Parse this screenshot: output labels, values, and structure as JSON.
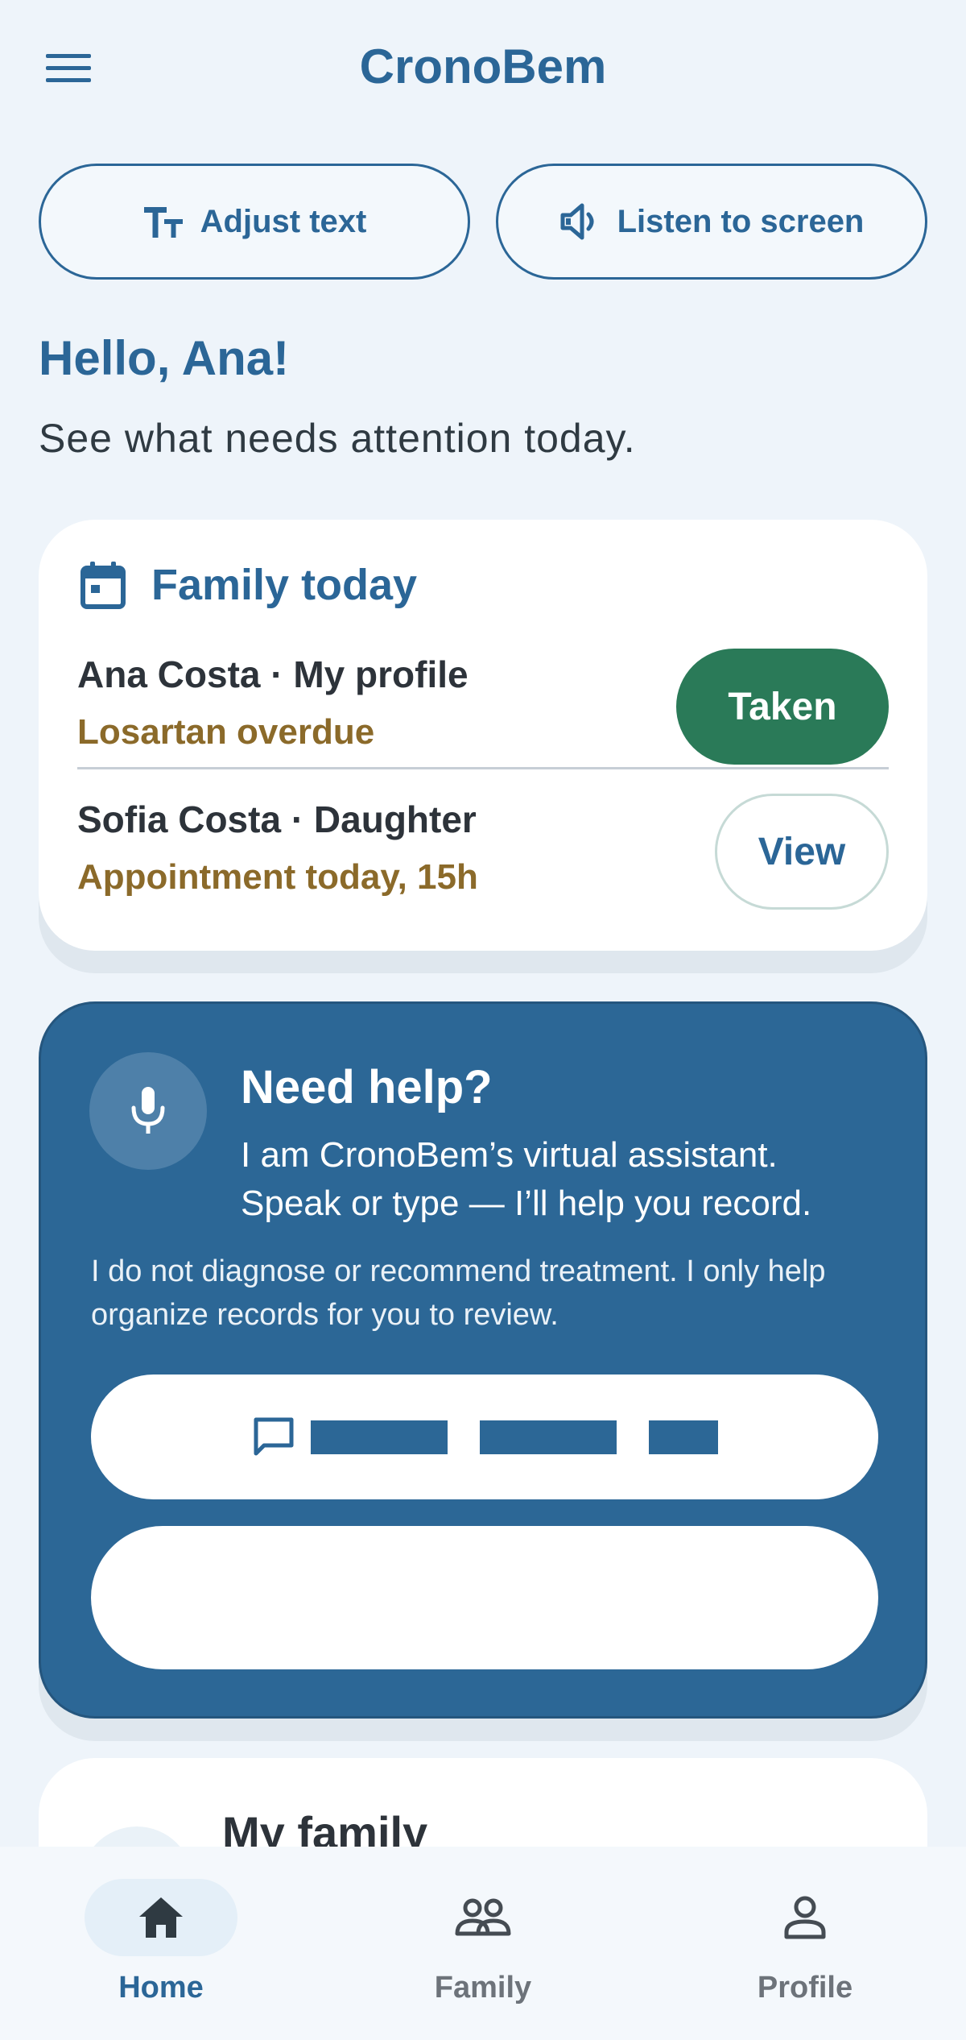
{
  "app": {
    "title": "CronoBem"
  },
  "icons": {
    "menu": "menu-icon",
    "adjust_text": "text-size-icon",
    "listen": "volume-icon",
    "calendar": "calendar-icon",
    "mic": "microphone-icon",
    "chat": "chat-icon",
    "home": "home-icon",
    "family": "group-icon",
    "profile": "person-icon"
  },
  "colors": {
    "brand": "#2b6697",
    "taken_button": "#2a7a58",
    "status_warning": "#8b6a2a",
    "background": "#eef4fa"
  },
  "accessibility": {
    "adjust_text_label": "Adjust text",
    "listen_label": "Listen to screen"
  },
  "greeting": {
    "title": "Hello, Ana!",
    "subtitle": "See what needs attention today."
  },
  "family_today": {
    "title": "Family today",
    "rows": [
      {
        "name": "Ana Costa · My profile",
        "status": "Losartan overdue",
        "action": "Taken"
      },
      {
        "name": "Sofia Costa · Daughter",
        "status": "Appointment today, 15h",
        "action": "View"
      }
    ]
  },
  "help": {
    "title": "Need help?",
    "intro": "I am CronoBem’s virtual assistant. Speak or type — I’ll help you record.",
    "disclaimer": "I do not diagnose or recommend treatment. I only help organize records for you to review."
  },
  "my_family": {
    "title": "My family"
  },
  "bottom_nav": {
    "items": [
      {
        "label": "Home",
        "active": true
      },
      {
        "label": "Family",
        "active": false
      },
      {
        "label": "Profile",
        "active": false
      }
    ]
  }
}
